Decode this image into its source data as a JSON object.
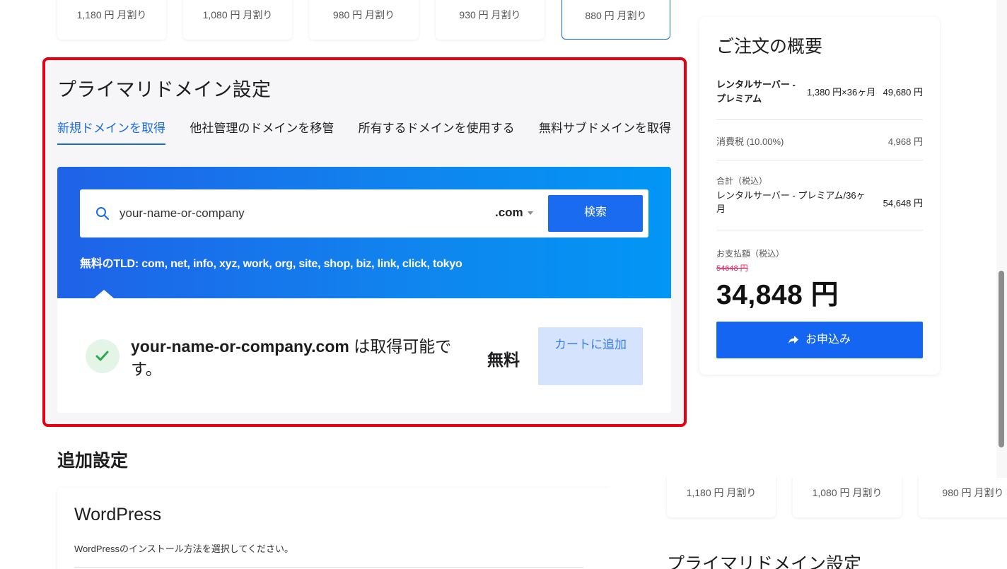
{
  "plans": [
    {
      "price": "1,180 円 月割り",
      "selected": false
    },
    {
      "price": "1,080 円 月割り",
      "selected": false
    },
    {
      "price": "980 円 月割り",
      "selected": false
    },
    {
      "price": "930 円 月割り",
      "selected": false
    },
    {
      "price": "880 円 月割り",
      "selected": true
    }
  ],
  "primary_domain": {
    "title": "プライマリドメイン設定",
    "tabs": [
      {
        "label": "新規ドメインを取得",
        "active": true
      },
      {
        "label": "他社管理のドメインを移管",
        "active": false
      },
      {
        "label": "所有するドメインを使用する",
        "active": false
      },
      {
        "label": "無料サブドメインを取得",
        "active": false
      }
    ],
    "search": {
      "value": "your-name-or-company",
      "tld": ".com",
      "button_label": "検索",
      "free_tld_text": "無料のTLD: com, net, info, xyz, work, org, site, shop, biz, link, click, tokyo"
    },
    "result": {
      "domain": "your-name-or-company.com",
      "status_text": " は取得可能です。",
      "price": "無料",
      "cart_button": "カートに追加"
    }
  },
  "additional": {
    "title": "追加設定",
    "wordpress_title": "WordPress",
    "wordpress_desc": "WordPressのインストール方法を選択してください。"
  },
  "summary": {
    "title": "ご注文の概要",
    "item_name": "レンタルサーバー - プレミアム",
    "item_term": "1,380 円×36ヶ月",
    "item_amount": "49,680 円",
    "tax_label": "消費税 (10.00%)",
    "tax_amount": "4,968 円",
    "total_label": "合計（税込）",
    "total_desc": "レンタルサーバー - プレミアム/36ヶ月",
    "total_amount": "54,648 円",
    "pay_label": "お支払額（税込）",
    "original_price": "54648 円",
    "final_price": "34,848 円",
    "apply_button": "お申込み"
  },
  "overlay": {
    "prices": [
      "1,180 円 月割り",
      "1,080 円 月割り",
      "980 円 月割り"
    ],
    "title": "プライマリドメイン設定"
  },
  "colors": {
    "accent": "#1a6bd8",
    "highlight_border": "#e60012",
    "strike": "#e0245e"
  }
}
